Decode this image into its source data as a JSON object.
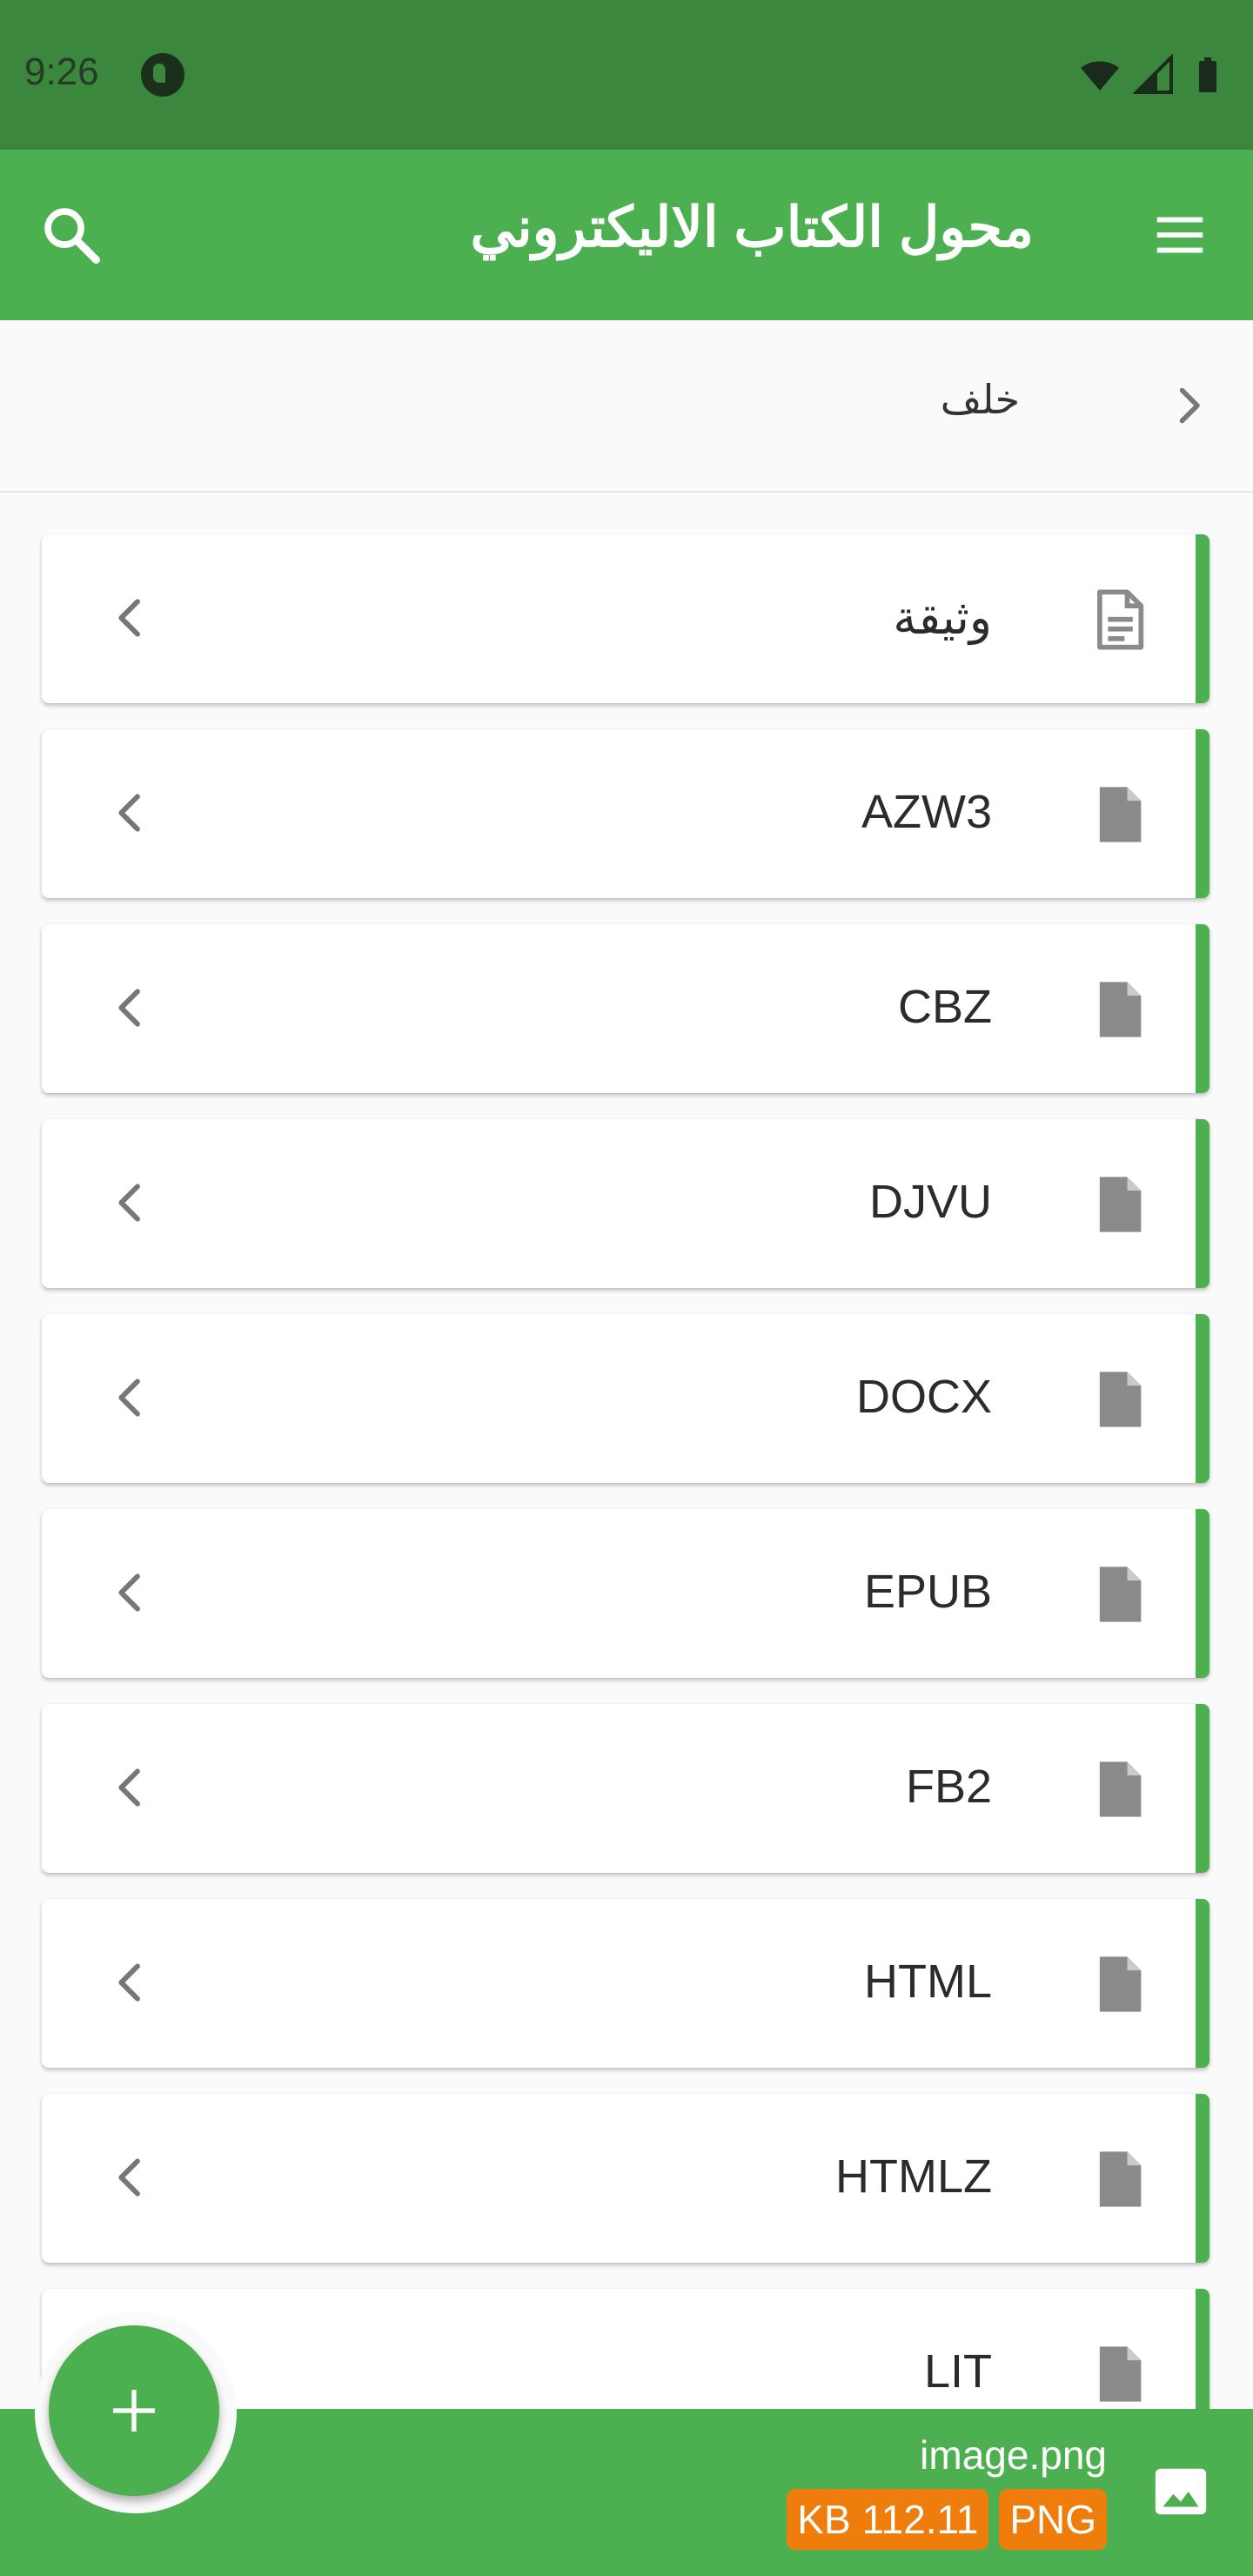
{
  "status_bar": {
    "time": "9:26"
  },
  "app_bar": {
    "title": "محول الكتاب الاليكتروني"
  },
  "back_row": {
    "label": "خلف"
  },
  "formats": [
    {
      "label": "وثيقة",
      "icon": "document-lines-icon"
    },
    {
      "label": "AZW3",
      "icon": "file-icon"
    },
    {
      "label": "CBZ",
      "icon": "file-icon"
    },
    {
      "label": "DJVU",
      "icon": "file-icon"
    },
    {
      "label": "DOCX",
      "icon": "file-icon"
    },
    {
      "label": "EPUB",
      "icon": "file-icon"
    },
    {
      "label": "FB2",
      "icon": "file-icon"
    },
    {
      "label": "HTML",
      "icon": "file-icon"
    },
    {
      "label": "HTMLZ",
      "icon": "file-icon"
    },
    {
      "label": "LIT",
      "icon": "file-icon"
    }
  ],
  "selected_file": {
    "name": "image.png",
    "size": "KB 112.11",
    "type": "PNG"
  },
  "colors": {
    "primary": "#4caf50",
    "status_bar": "#3b873e",
    "badge": "#ef7d0b",
    "icon_gray": "#8a8a8a"
  }
}
